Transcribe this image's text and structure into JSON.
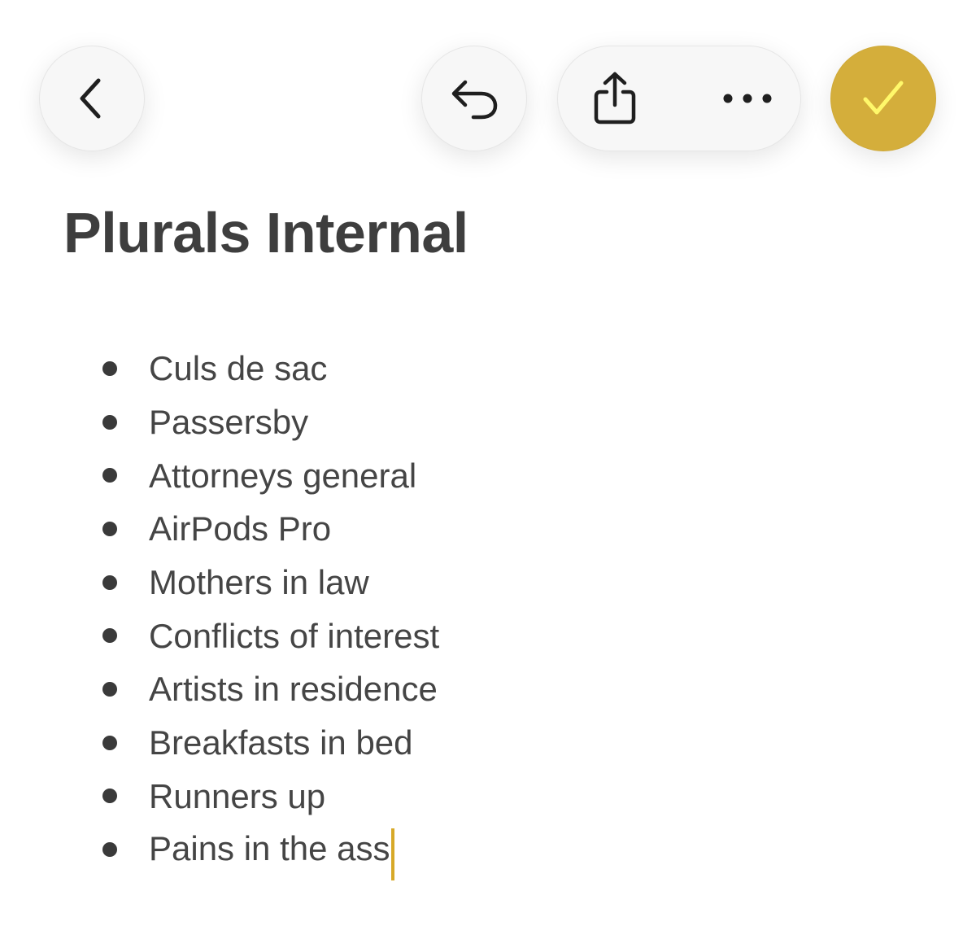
{
  "toolbar": {
    "back": {
      "icon": "chevron-left-icon"
    },
    "undo": {
      "icon": "undo-arrow-icon"
    },
    "share": {
      "icon": "share-icon"
    },
    "more": {
      "icon": "ellipsis-icon"
    },
    "done": {
      "icon": "checkmark-icon",
      "color": "#d4ae3b"
    }
  },
  "note": {
    "title": "Plurals Internal",
    "items": [
      "Culs de sac",
      "Passersby",
      "Attorneys general",
      "AirPods Pro",
      "Mothers in law",
      "Conflicts of interest",
      "Artists in residence",
      "Breakfasts in bed",
      "Runners up",
      "Pains in the ass"
    ]
  },
  "colors": {
    "accent": "#d4ae3b",
    "caret": "#d7a928",
    "text": "#454545"
  }
}
